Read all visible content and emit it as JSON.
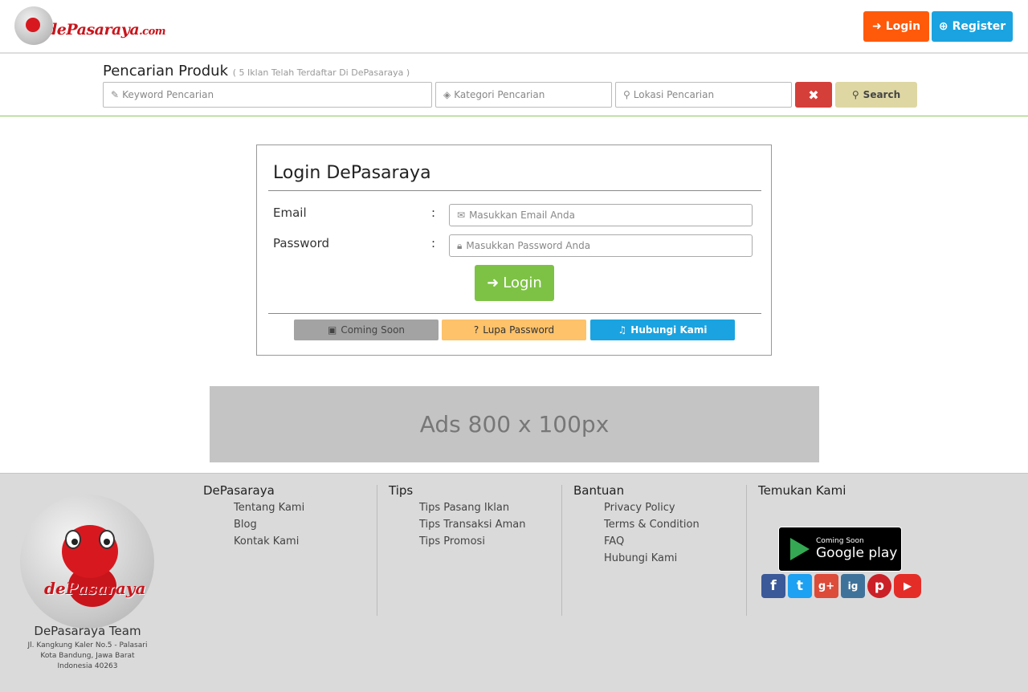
{
  "header": {
    "logo_text": "dePasaraya",
    "logo_domain": ".com",
    "login_label": "Login",
    "register_label": "Register"
  },
  "search": {
    "title": "Pencarian Produk",
    "subtitle": "( 5 Iklan Telah Terdaftar Di DePasaraya )",
    "keyword_placeholder": "Keyword Pencarian",
    "kategori_placeholder": "Kategori Pencarian",
    "lokasi_placeholder": "Lokasi Pencarian",
    "clear_label": "✖",
    "search_label": "Search"
  },
  "login_card": {
    "title": "Login DePasaraya",
    "email_label": "Email",
    "password_label": "Password",
    "colon": ":",
    "email_placeholder": "Masukkan Email Anda",
    "password_placeholder": "Masukkan Password Anda",
    "login_label": "Login",
    "coming_soon_label": "Coming Soon",
    "lupa_password_label": "Lupa Password",
    "hubungi_label": "Hubungi Kami"
  },
  "ads": {
    "label": "Ads 800 x 100px"
  },
  "footer": {
    "brand": "dePasaraya.com",
    "team_name": "DePasaraya Team",
    "address_line1": "Jl. Kangkung Kaler No.5 - Palasari",
    "address_line2": "Kota Bandung, Jawa Barat",
    "address_line3": "Indonesia 40263",
    "col1": {
      "title": "DePasaraya",
      "links": [
        "Tentang Kami",
        "Blog",
        "Kontak Kami"
      ]
    },
    "col2": {
      "title": "Tips",
      "links": [
        "Tips Pasang Iklan",
        "Tips Transaksi Aman",
        "Tips Promosi"
      ]
    },
    "col3": {
      "title": "Bantuan",
      "links": [
        "Privacy Policy",
        "Terms & Condition",
        "FAQ",
        "Hubungi Kami"
      ]
    },
    "col4": {
      "title": "Temukan Kami"
    },
    "gplay_small": "Coming Soon",
    "gplay_big": "Google play",
    "socials": [
      "f",
      "t",
      "g+",
      "ig",
      "p",
      "▶"
    ]
  },
  "colors": {
    "login_orange": "#ff5a0a",
    "register_blue": "#1aa3e0",
    "green": "#7dc245",
    "danger": "#d43f3a"
  }
}
